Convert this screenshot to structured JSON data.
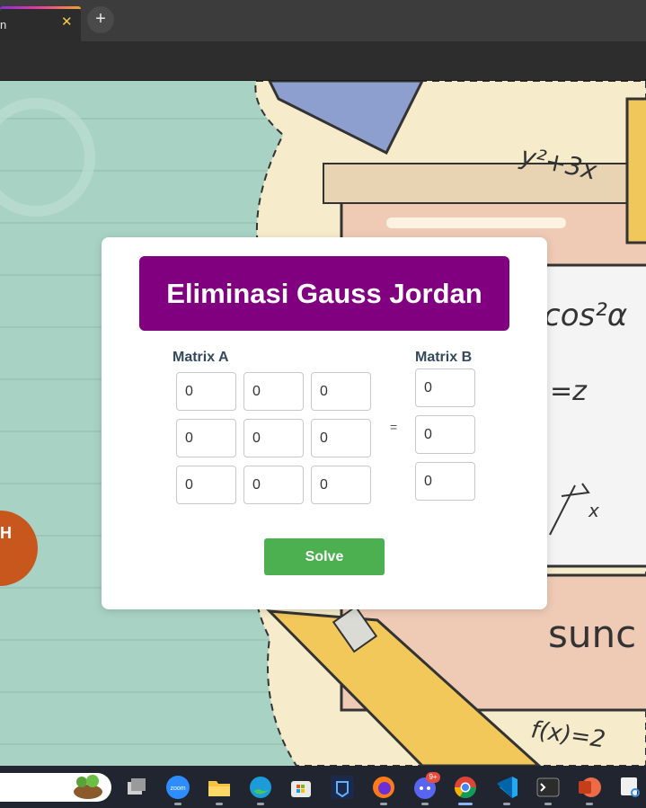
{
  "browser": {
    "tab_title": "n",
    "tab_close": "✕",
    "new_tab": "+"
  },
  "app": {
    "title": "Eliminasi Gauss Jordan",
    "matrix_a_label": "Matrix A",
    "matrix_b_label": "Matrix B",
    "equals": "=",
    "matrix_a": [
      [
        "0",
        "0",
        "0"
      ],
      [
        "0",
        "0",
        "0"
      ],
      [
        "0",
        "0",
        "0"
      ]
    ],
    "matrix_b": [
      "0",
      "0",
      "0"
    ],
    "solve_label": "Solve"
  },
  "background": {
    "doodles": [
      "y²+3x",
      "cos²α",
      "=z",
      "x",
      "sunc",
      "f(x)=2",
      "H"
    ]
  },
  "taskbar": {
    "apps": [
      "file-explorer-icon-gray",
      "zoom-icon",
      "folder-icon",
      "edge-icon",
      "store-icon",
      "security-icon",
      "firefox-icon",
      "discord-icon",
      "chrome-icon",
      "vscode-icon",
      "terminal-icon",
      "powerpoint-icon",
      "snipping-icon"
    ],
    "discord_badge": "9+",
    "zoom_label": "zoom"
  },
  "colors": {
    "title_bg": "#800080",
    "solve_bg": "#4caf50",
    "page_bg": "#a8d3c4"
  }
}
